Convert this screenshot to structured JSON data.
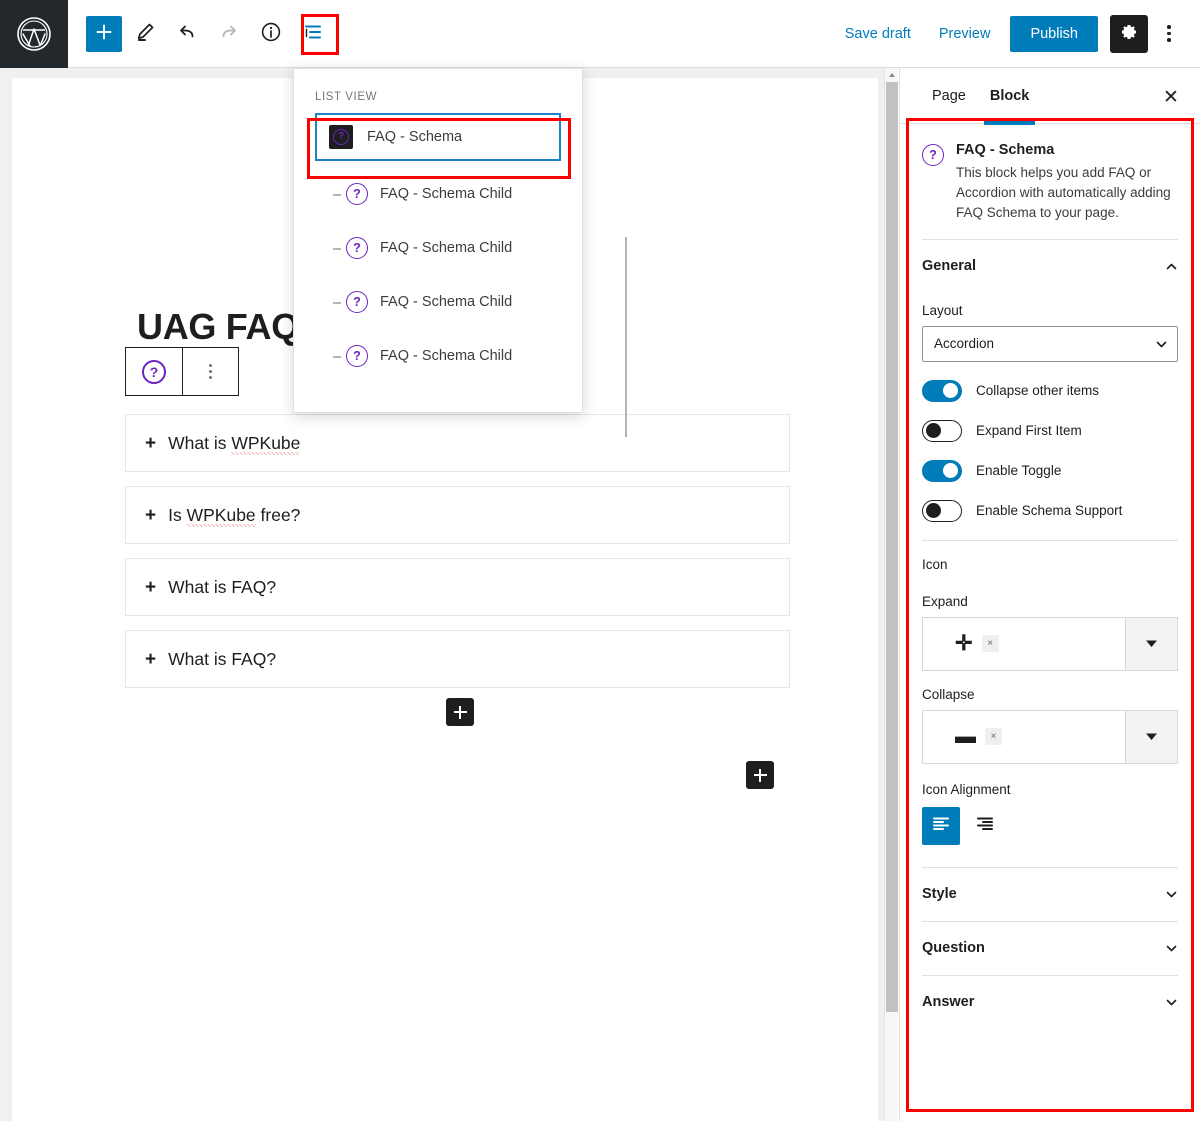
{
  "topbar": {
    "logo_icon": "wordpress-logo-icon",
    "add_block_icon": "plus-icon",
    "edit_icon": "pencil-icon",
    "undo_icon": "undo-arrow-icon",
    "redo_icon": "redo-arrow-icon",
    "info_icon": "info-circle-icon",
    "list_view_icon": "list-view-icon",
    "save_draft_label": "Save draft",
    "preview_label": "Preview",
    "publish_label": "Publish",
    "settings_icon": "gear-icon",
    "more_options_icon": "kebab-menu-icon",
    "accent_color": "#007cba"
  },
  "editor": {
    "post_title": "UAG FAQ E",
    "block_toolbar": {
      "block_icon": "faq-question-icon",
      "more_icon": "vertical-ellipsis-icon"
    },
    "faq_items": [
      {
        "expand_icon": "plus-icon",
        "question_pre": "What is ",
        "question_misspelled": "WPKube",
        "question_post": ""
      },
      {
        "expand_icon": "plus-icon",
        "question_pre": "Is ",
        "question_misspelled": "WPKube",
        "question_post": " free?"
      },
      {
        "expand_icon": "plus-icon",
        "question_pre": "What is FAQ?",
        "question_misspelled": "",
        "question_post": ""
      },
      {
        "expand_icon": "plus-icon",
        "question_pre": "What is FAQ?",
        "question_misspelled": "",
        "question_post": ""
      }
    ],
    "inner_add_icon": "add-block-icon",
    "outer_add_icon": "add-block-icon"
  },
  "list_view": {
    "title": "LIST VIEW",
    "parent": {
      "label": "FAQ - Schema",
      "icon": "faq-schema-block-icon",
      "selected": true
    },
    "children": [
      {
        "label": "FAQ - Schema Child",
        "icon": "faq-question-icon"
      },
      {
        "label": "FAQ - Schema Child",
        "icon": "faq-question-icon"
      },
      {
        "label": "FAQ - Schema Child",
        "icon": "faq-question-icon"
      },
      {
        "label": "FAQ - Schema Child",
        "icon": "faq-question-icon"
      }
    ]
  },
  "sidebar": {
    "tabs": [
      {
        "label": "Page",
        "active": false
      },
      {
        "label": "Block",
        "active": true
      }
    ],
    "close_icon": "close-icon",
    "block_info": {
      "icon": "faq-question-icon",
      "title": "FAQ - Schema",
      "description": "This block helps you add FAQ or Accordion with automatically adding FAQ Schema to your page."
    },
    "general": {
      "heading": "General",
      "expanded": true,
      "collapse_icon": "chevron-up-icon",
      "layout_label": "Layout",
      "layout_value": "Accordion",
      "layout_chevron_icon": "chevron-down-icon",
      "toggles": [
        {
          "label": "Collapse other items",
          "state": "on"
        },
        {
          "label": "Expand First Item",
          "state": "off"
        },
        {
          "label": "Enable Toggle",
          "state": "on"
        },
        {
          "label": "Enable Schema Support",
          "state": "off"
        }
      ],
      "icon_heading": "Icon",
      "expand_label": "Expand",
      "expand_icon_glyph": "plus-icon",
      "expand_clear_label": "×",
      "expand_dropdown_icon": "triangle-down-icon",
      "collapse_label": "Collapse",
      "collapse_icon_glyph": "minus-icon",
      "collapse_clear_label": "×",
      "collapse_dropdown_icon": "triangle-down-icon",
      "icon_alignment_label": "Icon Alignment",
      "align_left_icon": "align-left-icon",
      "align_right_icon": "align-right-icon",
      "align_selected": "left"
    },
    "sections": [
      {
        "heading": "Style",
        "expanded": false,
        "chevron_icon": "chevron-down-icon"
      },
      {
        "heading": "Question",
        "expanded": false,
        "chevron_icon": "chevron-down-icon"
      },
      {
        "heading": "Answer",
        "expanded": false,
        "chevron_icon": "chevron-down-icon"
      }
    ]
  },
  "annotations": {
    "highlight_color": "#ff0000",
    "targets": [
      "list-view-toolbar-button",
      "list-view-selected-parent-block",
      "block-settings-sidebar"
    ]
  }
}
